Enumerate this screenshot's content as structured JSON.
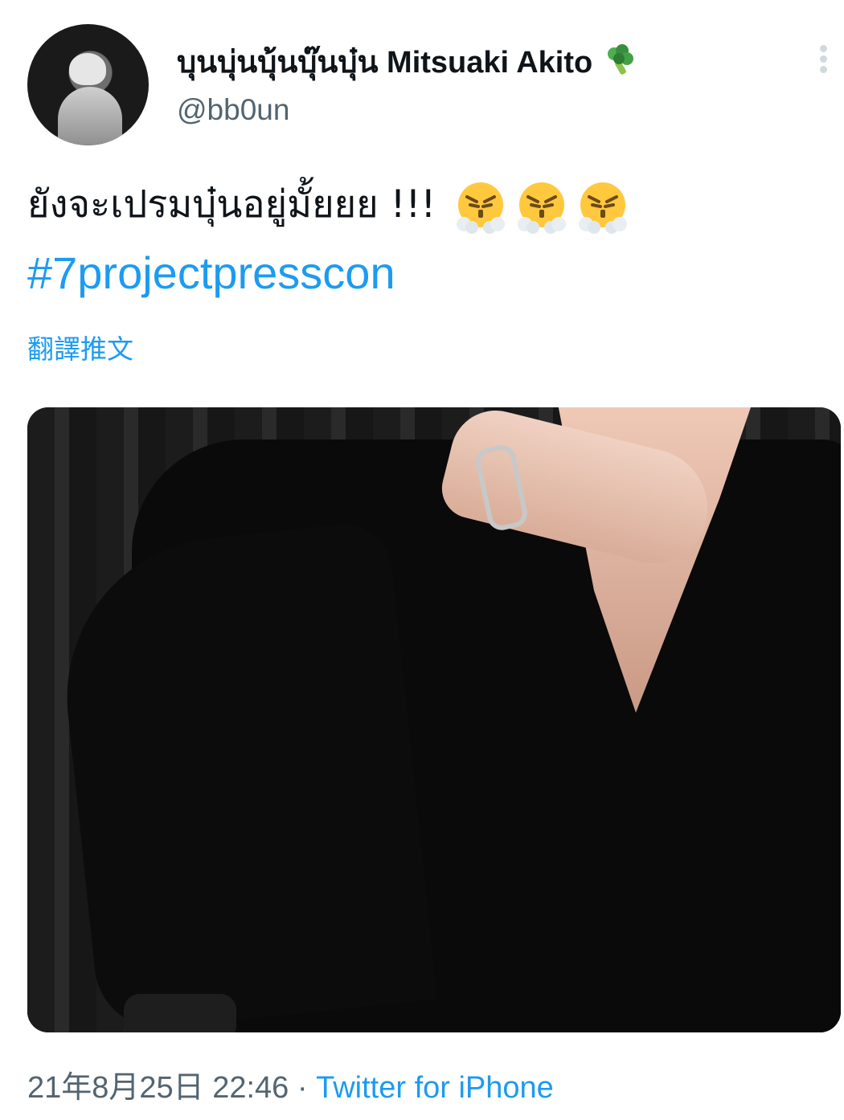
{
  "author": {
    "display_name": "บุนบุ่นบุ้นบุ๊นบุ๋น Mitsuaki Akito",
    "name_emoji": "broccoli-icon",
    "handle": "@bb0un"
  },
  "tweet": {
    "text": "ยังจะเปรมบุ๋นอยู่มั้ยยย !!!",
    "emojis": [
      "face-with-steam-from-nose-icon",
      "face-with-steam-from-nose-icon",
      "face-with-steam-from-nose-icon"
    ],
    "hashtag": "#7projectpresscon",
    "translate_label": "翻譯推文"
  },
  "meta": {
    "timestamp": "21年8月25日 22:46",
    "separator": "·",
    "source": "Twitter for iPhone"
  },
  "colors": {
    "link": "#1d9bf0",
    "secondary_text": "#536471",
    "primary_text": "#0f1419"
  }
}
